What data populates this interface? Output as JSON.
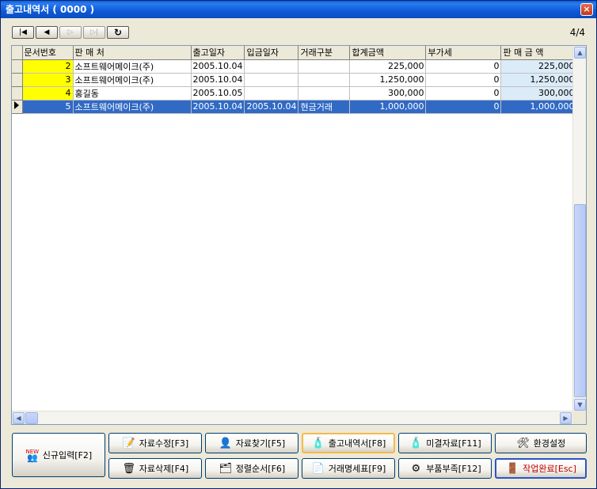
{
  "window": {
    "title": "출고내역서 ( 0000 )",
    "close_label": "×"
  },
  "nav": {
    "first": "|◀",
    "prev": "◀",
    "next": "▷",
    "last": "▷|",
    "refresh": "↻",
    "page_count": "4/4"
  },
  "table": {
    "columns": [
      "문서번호",
      "판 매 처",
      "출고일자",
      "입금일자",
      "거래구분",
      "합계금액",
      "부가세",
      "판 매 금 액"
    ],
    "rows": [
      {
        "doc_no": "2",
        "vendor": "소프트웨어메이크(주)",
        "ship_date": "2005.10.04",
        "pay_date": "",
        "type": "",
        "total": "225,000",
        "vat": "0",
        "sale": "225,000"
      },
      {
        "doc_no": "3",
        "vendor": "소프트웨어메이크(주)",
        "ship_date": "2005.10.04",
        "pay_date": "",
        "type": "",
        "total": "1,250,000",
        "vat": "0",
        "sale": "1,250,000"
      },
      {
        "doc_no": "4",
        "vendor": "홍길동",
        "ship_date": "2005.10.05",
        "pay_date": "",
        "type": "",
        "total": "300,000",
        "vat": "0",
        "sale": "300,000"
      },
      {
        "doc_no": "5",
        "vendor": "소프트웨어메이크(주)",
        "ship_date": "2005.10.04",
        "pay_date": "2005.10.04",
        "type": "현금거래",
        "total": "1,000,000",
        "vat": "0",
        "sale": "1,000,000"
      }
    ]
  },
  "buttons": {
    "new_entry": "신규입력[F2]",
    "new_badge": "NEW",
    "edit": "자료수정[F3]",
    "delete": "자료삭제[F4]",
    "search": "자료찾기[F5]",
    "sort": "정렬순서[F6]",
    "shipment": "출고내역서[F8]",
    "invoice": "거래명세표[F9]",
    "unsettled": "미결자료[F11]",
    "parts_short": "부품부족[F12]",
    "settings": "환경설정",
    "done": "작업완료[Esc]"
  }
}
